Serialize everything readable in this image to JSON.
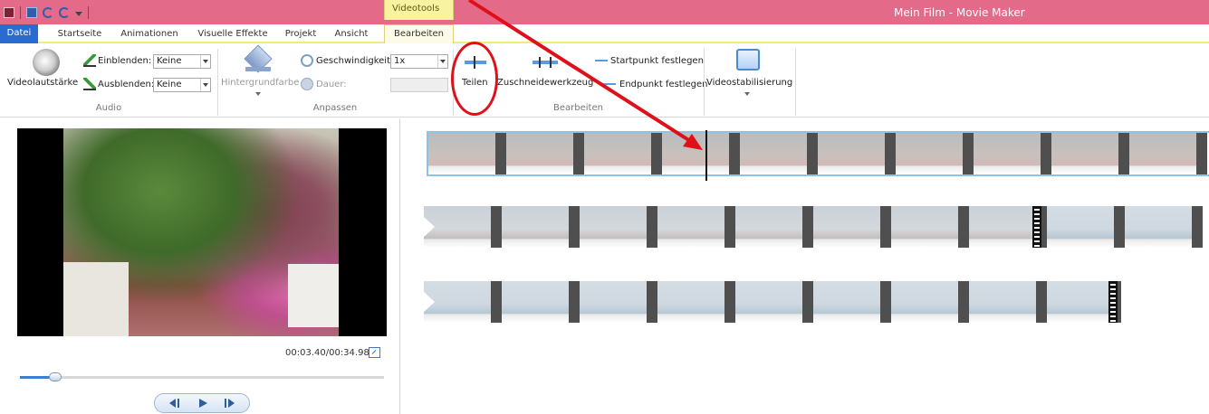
{
  "window": {
    "title": "Mein Film - Movie Maker",
    "context_group": "Videotools"
  },
  "tabs": [
    {
      "label": "Datei"
    },
    {
      "label": "Startseite"
    },
    {
      "label": "Animationen"
    },
    {
      "label": "Visuelle Effekte"
    },
    {
      "label": "Projekt"
    },
    {
      "label": "Ansicht"
    },
    {
      "label": "Bearbeiten"
    }
  ],
  "ribbon": {
    "audio": {
      "group_label": "Audio",
      "volume_label": "Videolautstärke",
      "fade_in_label": "Einblenden:",
      "fade_in_value": "Keine",
      "fade_out_label": "Ausblenden:",
      "fade_out_value": "Keine"
    },
    "adjust": {
      "group_label": "Anpassen",
      "background_label": "Hintergrundfarbe",
      "speed_label": "Geschwindigkeit:",
      "speed_value": "1x",
      "duration_label": "Dauer:"
    },
    "edit": {
      "group_label": "Bearbeiten",
      "split_label": "Teilen",
      "trim_label": "Zuschneidewerkzeug",
      "start_label": "Startpunkt festlegen",
      "end_label": "Endpunkt festlegen"
    },
    "stabilize": {
      "label": "Videostabilisierung"
    }
  },
  "preview": {
    "time": "00:03.40/00:34.98",
    "seek_fraction": 0.097
  },
  "colors": {
    "titlebar": "#e46a8a",
    "file_tab": "#2a6bcf",
    "context_tab": "#f7f3a0",
    "annotation": "#e0101b",
    "selection": "#8cc4e6"
  }
}
